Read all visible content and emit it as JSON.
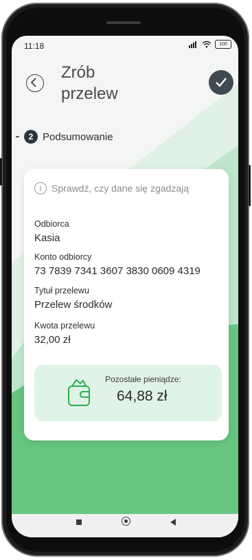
{
  "status_bar": {
    "time": "11:18",
    "battery": "100"
  },
  "header": {
    "title_line1": "Zrób",
    "title_line2": "przelew"
  },
  "step": {
    "number": "2",
    "label": "Podsumowanie"
  },
  "card": {
    "info_text": "Sprawdź, czy dane się zgadzają",
    "fields": [
      {
        "label": "Odbiorca",
        "value": "Kasia"
      },
      {
        "label": "Konto odbiorcy",
        "value": "73 7839 7341 3607 3830 0609 4319"
      },
      {
        "label": "Tytuł przelewu",
        "value": "Przelew środków"
      },
      {
        "label": "Kwota przelewu",
        "value": "32,00 zł"
      }
    ],
    "remaining": {
      "label": "Pozostałe pieniądze:",
      "value": "64,88 zł"
    }
  },
  "colors": {
    "brand_green": "#2bb14f",
    "light_green": "#dff3e6",
    "dark": "#3f4a53"
  },
  "icons": [
    "back-arrow-icon",
    "check-icon",
    "info-icon",
    "wallet-icon",
    "signal-icon",
    "wifi-icon",
    "battery-icon"
  ]
}
